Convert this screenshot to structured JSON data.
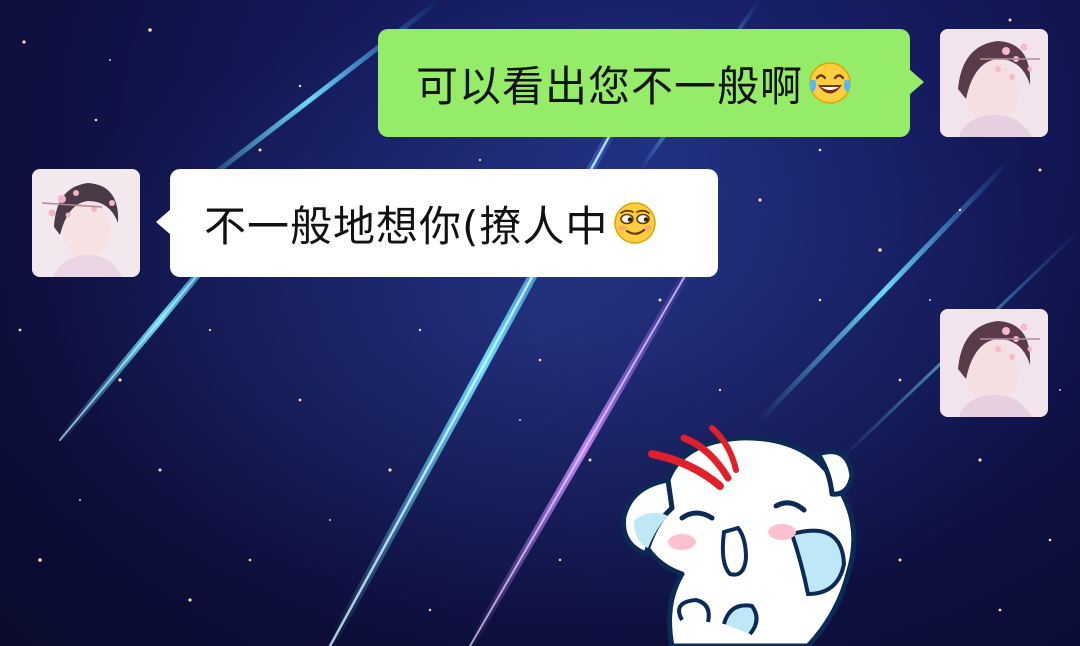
{
  "messages": [
    {
      "direction": "outgoing",
      "type": "text",
      "text": "可以看出您不一般啊",
      "emoji": "tears-of-joy-emoji"
    },
    {
      "direction": "incoming",
      "type": "text",
      "text": "不一般地想你(撩人中",
      "emoji": "smirk-emoji"
    },
    {
      "direction": "outgoing",
      "type": "sticker",
      "sticker": "cartoon-blob-sticker"
    }
  ],
  "colors": {
    "outgoing_bubble": "#95ec69",
    "incoming_bubble": "#ffffff",
    "background": "#14195a"
  },
  "background_name": "starry-night-meteor-wallpaper"
}
